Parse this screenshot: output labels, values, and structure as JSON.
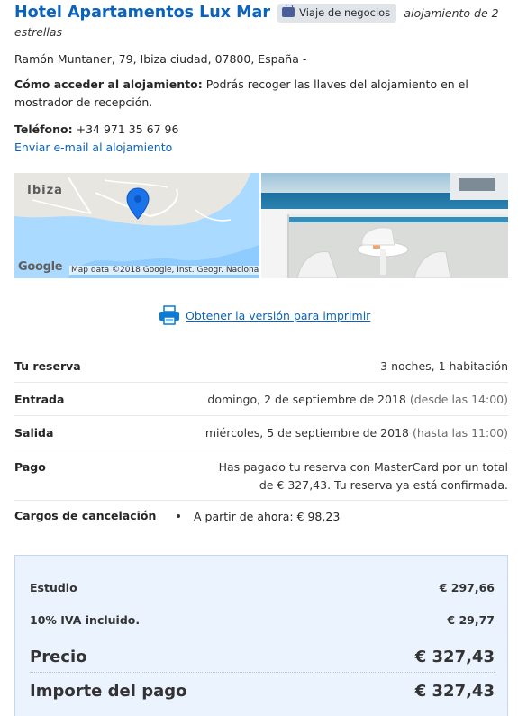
{
  "hotel": {
    "name": "Hotel Apartamentos Lux Mar",
    "badge": "Viaje de negocios",
    "stars_text": "alojamiento de 2 estrellas",
    "address": "Ramón Muntaner, 79, Ibiza ciudad, 07800, España -",
    "access_label": "Cómo acceder al alojamiento:",
    "access_text": "Podrás recoger las llaves del alojamiento en el mostrador de recepción.",
    "phone_label": "Teléfono:",
    "phone": "+34 971 35 67 96",
    "email_link": "Enviar e-mail al alojamiento"
  },
  "map": {
    "city_label": "Ibiza",
    "google_logo": "Google",
    "credit": "Map data ©2018 Google, Inst. Geogr. Nacional"
  },
  "print": {
    "link": "Obtener la versión para imprimir"
  },
  "reservation": {
    "rows": [
      {
        "label": "Tu reserva",
        "value": "3 noches, 1 habitación",
        "note": ""
      },
      {
        "label": "Entrada",
        "value": "domingo, 2 de septiembre de 2018",
        "note": "(desde las 14:00)"
      },
      {
        "label": "Salida",
        "value": "miércoles, 5 de septiembre de 2018",
        "note": "(hasta las 11:00)"
      },
      {
        "label": "Pago",
        "value": "Has pagado tu reserva con MasterCard por un total de € 327,43. Tu reserva ya está confirmada.",
        "note": ""
      },
      {
        "label": "Cargos de cancelación",
        "value": "A partir de ahora: € 98,23",
        "note": ""
      }
    ]
  },
  "prices": {
    "studio_label": "Estudio",
    "studio_value": "€ 297,66",
    "vat_label": "10% IVA incluido.",
    "vat_value": "€ 29,77",
    "price_label": "Precio",
    "price_value": "€ 327,43",
    "payment_label": "Importe del pago",
    "payment_value": "€ 327,43"
  },
  "colors": {
    "link": "#0a63bd",
    "price_box_bg": "#ebf3ff",
    "badge_bg": "#e1e5ea"
  }
}
